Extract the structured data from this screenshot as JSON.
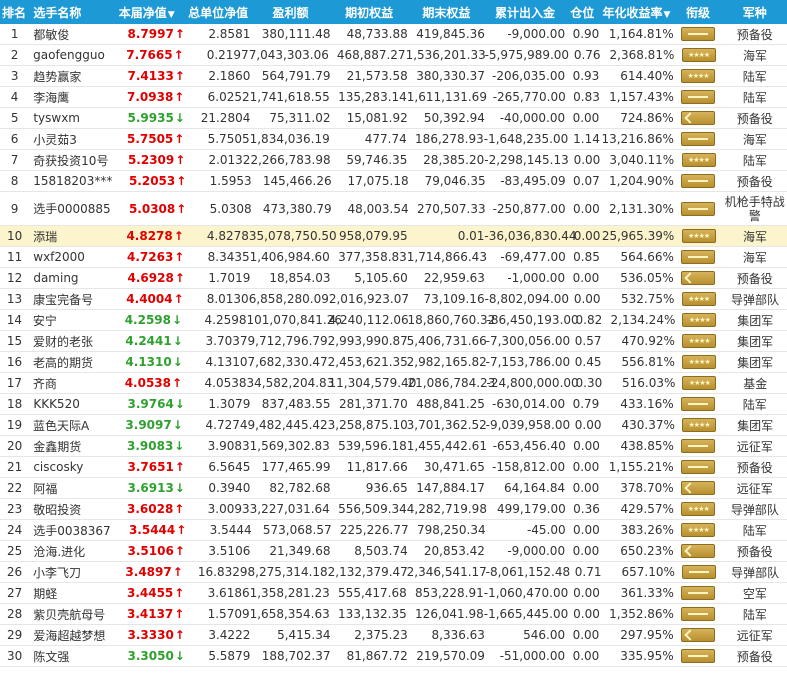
{
  "headers": {
    "rank": "排名",
    "name": "选手名称",
    "nav": "本届净值",
    "tnav": "总单位净值",
    "profit": "盈利额",
    "begin": "期初权益",
    "end": "期末权益",
    "flow": "累计出入金",
    "pos": "仓位",
    "ann": "年化收益率",
    "rankc": "衔级",
    "army": "军种",
    "sort_icon": "▼"
  },
  "rows": [
    {
      "rank": "1",
      "name": "都敏俊",
      "nav": "8.7997",
      "dir": "up",
      "tnav": "2.8581",
      "profit": "380,111.48",
      "begin": "48,733.88",
      "end": "419,845.36",
      "flow": "-9,000.00",
      "pos": "0.90",
      "ann": "1,164.81%",
      "army": "预备役",
      "ins": "bar"
    },
    {
      "rank": "2",
      "name": "gaofengguo",
      "nav": "7.7665",
      "dir": "up",
      "tnav": "0.2197",
      "profit": "7,043,303.06",
      "begin": "468,887.27",
      "end": "1,536,201.33",
      "flow": "-5,975,989.00",
      "pos": "0.76",
      "ann": "2,368.81%",
      "army": "海军",
      "ins": "dots"
    },
    {
      "rank": "3",
      "name": "趋势赢家",
      "nav": "7.4133",
      "dir": "up",
      "tnav": "2.1860",
      "profit": "564,791.79",
      "begin": "21,573.58",
      "end": "380,330.37",
      "flow": "-206,035.00",
      "pos": "0.93",
      "ann": "614.40%",
      "army": "陆军",
      "ins": "dots"
    },
    {
      "rank": "4",
      "name": "李海鹰",
      "nav": "7.0938",
      "dir": "up",
      "tnav": "6.0252",
      "profit": "1,741,618.55",
      "begin": "135,283.14",
      "end": "1,611,131.69",
      "flow": "-265,770.00",
      "pos": "0.83",
      "ann": "1,157.43%",
      "army": "陆军",
      "ins": "bar"
    },
    {
      "rank": "5",
      "name": "tyswxm",
      "nav": "5.9935",
      "dir": "down",
      "tnav": "21.2804",
      "profit": "75,311.02",
      "begin": "15,081.92",
      "end": "50,392.94",
      "flow": "-40,000.00",
      "pos": "0.00",
      "ann": "724.86%",
      "army": "预备役",
      "ins": "chev"
    },
    {
      "rank": "6",
      "name": "小灵茹3",
      "nav": "5.7505",
      "dir": "up",
      "tnav": "5.7505",
      "profit": "1,834,036.19",
      "begin": "477.74",
      "end": "186,278.93",
      "flow": "-1,648,235.00",
      "pos": "1.14",
      "ann": "13,216.86%",
      "army": "海军",
      "ins": "bar"
    },
    {
      "rank": "7",
      "name": "奇获投资10号",
      "nav": "5.2309",
      "dir": "up",
      "tnav": "2.0132",
      "profit": "2,266,783.98",
      "begin": "59,746.35",
      "end": "28,385.20",
      "flow": "-2,298,145.13",
      "pos": "0.00",
      "ann": "3,040.11%",
      "army": "陆军",
      "ins": "dots"
    },
    {
      "rank": "8",
      "name": "15818203***",
      "nav": "5.2053",
      "dir": "up",
      "tnav": "1.5953",
      "profit": "145,466.26",
      "begin": "17,075.18",
      "end": "79,046.35",
      "flow": "-83,495.09",
      "pos": "0.07",
      "ann": "1,204.90%",
      "army": "预备役",
      "ins": "bar"
    },
    {
      "rank": "9",
      "name": "选手0000885",
      "nav": "5.0308",
      "dir": "up",
      "tnav": "5.0308",
      "profit": "473,380.79",
      "begin": "48,003.54",
      "end": "270,507.33",
      "flow": "-250,877.00",
      "pos": "0.00",
      "ann": "2,131.30%",
      "army": "机枪手特战警",
      "ins": "bar",
      "tall": true
    },
    {
      "rank": "10",
      "name": "添瑞",
      "nav": "4.8278",
      "dir": "up",
      "tnav": "4.8278",
      "profit": "35,078,750.50",
      "begin": "958,079.95",
      "end": "0.01",
      "flow": "-36,036,830.44",
      "pos": "0.00",
      "ann": "25,965.39%",
      "army": "海军",
      "ins": "dots",
      "hl": true
    },
    {
      "rank": "11",
      "name": "wxf2000",
      "nav": "4.7263",
      "dir": "up",
      "tnav": "8.3435",
      "profit": "1,406,984.60",
      "begin": "377,358.83",
      "end": "1,714,866.43",
      "flow": "-69,477.00",
      "pos": "0.85",
      "ann": "564.66%",
      "army": "海军",
      "ins": "bar"
    },
    {
      "rank": "12",
      "name": "daming",
      "nav": "4.6928",
      "dir": "up",
      "tnav": "1.7019",
      "profit": "18,854.03",
      "begin": "5,105.60",
      "end": "22,959.63",
      "flow": "-1,000.00",
      "pos": "0.00",
      "ann": "536.05%",
      "army": "预备役",
      "ins": "chev"
    },
    {
      "rank": "13",
      "name": "康宝完备号",
      "nav": "4.4004",
      "dir": "up",
      "tnav": "8.0130",
      "profit": "6,858,280.09",
      "begin": "2,016,923.07",
      "end": "73,109.16",
      "flow": "-8,802,094.00",
      "pos": "0.00",
      "ann": "532.75%",
      "army": "导弹部队",
      "ins": "dots"
    },
    {
      "rank": "14",
      "name": "安宁",
      "nav": "4.2598",
      "dir": "down",
      "tnav": "4.2598",
      "profit": "101,070,841.26",
      "begin": "4,240,112.06",
      "end": "18,860,760.32",
      "flow": "-86,450,193.00",
      "pos": "0.82",
      "ann": "2,134.24%",
      "army": "集团军",
      "ins": "dots"
    },
    {
      "rank": "15",
      "name": "爱财的老张",
      "nav": "4.2441",
      "dir": "down",
      "tnav": "3.7037",
      "profit": "9,712,796.79",
      "begin": "2,993,990.87",
      "end": "5,406,731.66",
      "flow": "-7,300,056.00",
      "pos": "0.57",
      "ann": "470.92%",
      "army": "集团军",
      "ins": "dots"
    },
    {
      "rank": "16",
      "name": "老高的期货",
      "nav": "4.1310",
      "dir": "down",
      "tnav": "4.1310",
      "profit": "7,682,330.47",
      "begin": "2,453,621.35",
      "end": "2,982,165.82",
      "flow": "-7,153,786.00",
      "pos": "0.45",
      "ann": "556.81%",
      "army": "集团军",
      "ins": "dots"
    },
    {
      "rank": "17",
      "name": "齐商",
      "nav": "4.0538",
      "dir": "up",
      "tnav": "4.0538",
      "profit": "34,582,204.83",
      "begin": "11,304,579.40",
      "end": "21,086,784.23",
      "flow": "-24,800,000.00",
      "pos": "0.30",
      "ann": "516.03%",
      "army": "基金",
      "ins": "dots"
    },
    {
      "rank": "18",
      "name": "KKK520",
      "nav": "3.9764",
      "dir": "down",
      "tnav": "1.3079",
      "profit": "837,483.55",
      "begin": "281,371.70",
      "end": "488,841.25",
      "flow": "-630,014.00",
      "pos": "0.79",
      "ann": "433.16%",
      "army": "陆军",
      "ins": "bar"
    },
    {
      "rank": "19",
      "name": "蓝色天际A",
      "nav": "3.9097",
      "dir": "down",
      "tnav": "4.7274",
      "profit": "9,482,445.42",
      "begin": "3,258,875.10",
      "end": "3,701,362.52",
      "flow": "-9,039,958.00",
      "pos": "0.00",
      "ann": "430.37%",
      "army": "集团军",
      "ins": "dots"
    },
    {
      "rank": "20",
      "name": "金鑫期货",
      "nav": "3.9083",
      "dir": "down",
      "tnav": "3.9083",
      "profit": "1,569,302.83",
      "begin": "539,596.18",
      "end": "1,455,442.61",
      "flow": "-653,456.40",
      "pos": "0.00",
      "ann": "438.85%",
      "army": "远征军",
      "ins": "bar"
    },
    {
      "rank": "21",
      "name": "ciscosky",
      "nav": "3.7651",
      "dir": "up",
      "tnav": "6.5645",
      "profit": "177,465.99",
      "begin": "11,817.66",
      "end": "30,471.65",
      "flow": "-158,812.00",
      "pos": "0.00",
      "ann": "1,155.21%",
      "army": "预备役",
      "ins": "bar"
    },
    {
      "rank": "22",
      "name": "阿福",
      "nav": "3.6913",
      "dir": "down",
      "tnav": "0.3940",
      "profit": "82,782.68",
      "begin": "936.65",
      "end": "147,884.17",
      "flow": "64,164.84",
      "pos": "0.00",
      "ann": "378.70%",
      "army": "远征军",
      "ins": "chev"
    },
    {
      "rank": "23",
      "name": "敬昭投资",
      "nav": "3.6028",
      "dir": "up",
      "tnav": "3.0093",
      "profit": "3,227,031.64",
      "begin": "556,509.34",
      "end": "4,282,719.98",
      "flow": "499,179.00",
      "pos": "0.36",
      "ann": "429.57%",
      "army": "导弹部队",
      "ins": "dots"
    },
    {
      "rank": "24",
      "name": "选手0038367",
      "nav": "3.5444",
      "dir": "up",
      "tnav": "3.5444",
      "profit": "573,068.57",
      "begin": "225,226.77",
      "end": "798,250.34",
      "flow": "-45.00",
      "pos": "0.00",
      "ann": "383.26%",
      "army": "陆军",
      "ins": "dots"
    },
    {
      "rank": "25",
      "name": "沧海.进化",
      "nav": "3.5106",
      "dir": "up",
      "tnav": "3.5106",
      "profit": "21,349.68",
      "begin": "8,503.74",
      "end": "20,853.42",
      "flow": "-9,000.00",
      "pos": "0.00",
      "ann": "650.23%",
      "army": "预备役",
      "ins": "chev"
    },
    {
      "rank": "26",
      "name": "小李飞刀",
      "nav": "3.4897",
      "dir": "up",
      "tnav": "16.8329",
      "profit": "8,275,314.18",
      "begin": "2,132,379.47",
      "end": "2,346,541.17",
      "flow": "-8,061,152.48",
      "pos": "0.71",
      "ann": "657.10%",
      "army": "导弹部队",
      "ins": "bar"
    },
    {
      "rank": "27",
      "name": "期蛏",
      "nav": "3.4455",
      "dir": "up",
      "tnav": "3.6186",
      "profit": "1,358,281.23",
      "begin": "555,417.68",
      "end": "853,228.91",
      "flow": "-1,060,470.00",
      "pos": "0.00",
      "ann": "361.33%",
      "army": "空军",
      "ins": "bar"
    },
    {
      "rank": "28",
      "name": "紫贝壳航母号",
      "nav": "3.4137",
      "dir": "up",
      "tnav": "1.5709",
      "profit": "1,658,354.63",
      "begin": "133,132.35",
      "end": "126,041.98",
      "flow": "-1,665,445.00",
      "pos": "0.00",
      "ann": "1,352.86%",
      "army": "陆军",
      "ins": "bar"
    },
    {
      "rank": "29",
      "name": "爱海超越梦想",
      "nav": "3.3330",
      "dir": "up",
      "tnav": "3.4222",
      "profit": "5,415.34",
      "begin": "2,375.23",
      "end": "8,336.63",
      "flow": "546.00",
      "pos": "0.00",
      "ann": "297.95%",
      "army": "远征军",
      "ins": "chev"
    },
    {
      "rank": "30",
      "name": "陈文强",
      "nav": "3.3050",
      "dir": "down",
      "tnav": "5.5879",
      "profit": "188,702.37",
      "begin": "81,867.72",
      "end": "219,570.09",
      "flow": "-51,000.00",
      "pos": "0.00",
      "ann": "335.95%",
      "army": "预备役",
      "ins": "bar"
    }
  ],
  "colors": {
    "header_bg": "#1d9ad6",
    "highlight_row": "#fbf4cc",
    "up": "#e00000",
    "down": "#2ea12e",
    "insignia": "#c9a548"
  },
  "icons": {
    "up": "arrow-up-icon",
    "down": "arrow-down-icon",
    "sort": "sort-desc-icon",
    "insignia": "rank-insignia-icon"
  }
}
